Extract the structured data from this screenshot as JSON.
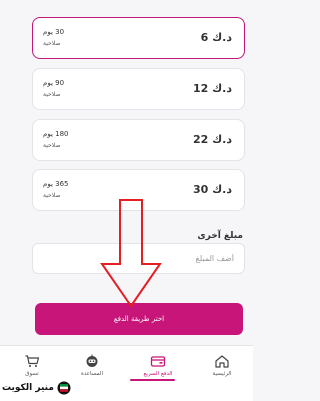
{
  "plans": [
    {
      "price": "د.ك 6",
      "days": "30 يوم",
      "validity": "صلاحية",
      "selected": true
    },
    {
      "price": "د.ك 12",
      "days": "90 يوم",
      "validity": "صلاحية",
      "selected": false
    },
    {
      "price": "د.ك 22",
      "days": "180 يوم",
      "validity": "صلاحية",
      "selected": false
    },
    {
      "price": "د.ك 30",
      "days": "365 يوم",
      "validity": "صلاحية",
      "selected": false
    }
  ],
  "other_amount": {
    "label": "مبلغ آخرى",
    "placeholder": "أضف المبلغ"
  },
  "pay_button": "اختر طريقة الدفع",
  "tabs": [
    {
      "label": "الرئيسية",
      "icon": "home-icon"
    },
    {
      "label": "الدفع السريع",
      "icon": "wallet-icon",
      "active": true
    },
    {
      "label": "المساعدة",
      "icon": "robot-icon"
    },
    {
      "label": "تسوق",
      "icon": "cart-icon"
    }
  ],
  "logo": "منير الكويت",
  "colors": {
    "accent": "#c8157a",
    "arrow": "#e31e24"
  }
}
